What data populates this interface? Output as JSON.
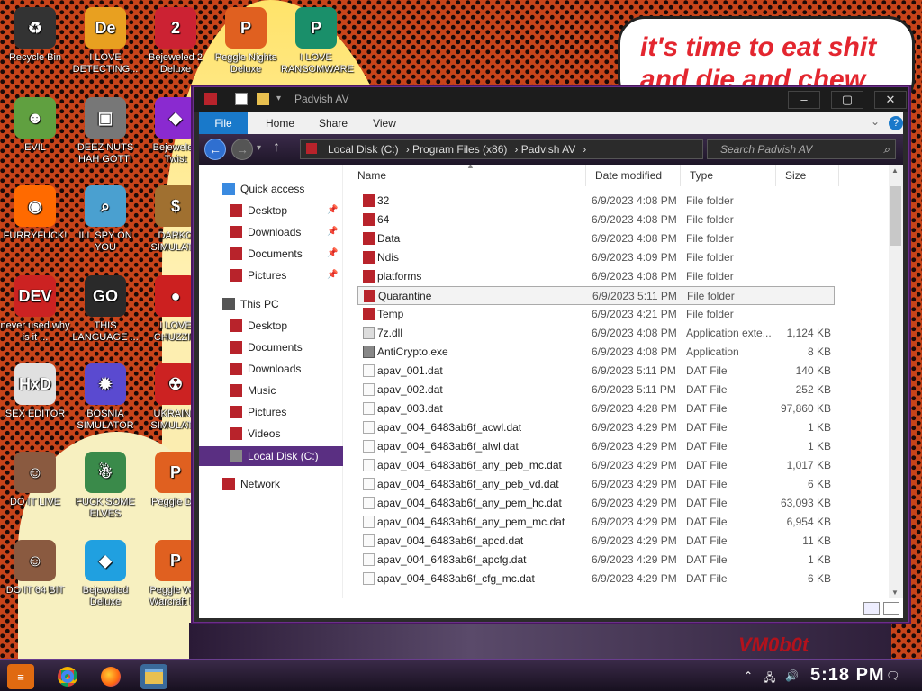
{
  "wallpaper": {
    "speech_text": "it's time to eat shit and die and chew",
    "watermark": "VM0b0t"
  },
  "desktop_icons": [
    {
      "label": "Recycle Bin",
      "glyph": "♻",
      "color": "#333333"
    },
    {
      "label": "I LOVE DETECTING...",
      "glyph": "De",
      "color": "#e8a020"
    },
    {
      "label": "Bejeweled 2 Deluxe",
      "glyph": "2",
      "color": "#cc2233"
    },
    {
      "label": "Peggle Nights Deluxe",
      "glyph": "P",
      "color": "#e06020"
    },
    {
      "label": "I LOVE RANSOMWARE",
      "glyph": "P",
      "color": "#1a8f6a"
    },
    {
      "label": "EVIL",
      "glyph": "☻",
      "color": "#60a040"
    },
    {
      "label": "DEEZ NUTS HAH GOTTI",
      "glyph": "▣",
      "color": "#777777"
    },
    {
      "label": "Bejeweled Twist",
      "glyph": "◆",
      "color": "#8a2ad0"
    },
    {
      "label": "FURRYFUCK!",
      "glyph": "◉",
      "color": "#ff6a00"
    },
    {
      "label": "ILL SPY ON YOU",
      "glyph": "⌕",
      "color": "#4aa0d0"
    },
    {
      "label": "DARKO SIMULATO",
      "glyph": "$",
      "color": "#a07030"
    },
    {
      "label": "never used why is it ...",
      "glyph": "DEV",
      "color": "#cc2222"
    },
    {
      "label": "THIS LANGUAGE ...",
      "glyph": "GO",
      "color": "#2a2a2a"
    },
    {
      "label": "I LOVE CHUZZIN",
      "glyph": "●",
      "color": "#cc2020"
    },
    {
      "label": "SEX EDITOR",
      "glyph": "HxD",
      "color": "#e0e0e0"
    },
    {
      "label": "BOSNIA SIMULATOR",
      "glyph": "✹",
      "color": "#5a4ad0"
    },
    {
      "label": "UKRAINE SIMULATO",
      "glyph": "☢",
      "color": "#cc2222"
    },
    {
      "label": "DO IT LIVE",
      "glyph": "☺",
      "color": "#8a5a40"
    },
    {
      "label": "FUCK SOME ELVES",
      "glyph": "☃",
      "color": "#3a8a4a"
    },
    {
      "label": "Peggle Del",
      "glyph": "P",
      "color": "#e06020"
    },
    {
      "label": "DO IT 64 BIT",
      "glyph": "☺",
      "color": "#8a5a40"
    },
    {
      "label": "Bejeweled Deluxe",
      "glyph": "◆",
      "color": "#20a0e0"
    },
    {
      "label": "Peggle Wor Warcraft Ed",
      "glyph": "P",
      "color": "#e06020"
    }
  ],
  "window": {
    "title": "Padvish AV",
    "min": "–",
    "max": "▢",
    "close": "✕",
    "help": "?",
    "ribbon_expand": "⌄",
    "tabs": [
      "File",
      "Home",
      "Share",
      "View"
    ],
    "breadcrumb": [
      "Local Disk (C:)",
      "Program Files (x86)",
      "Padvish AV"
    ],
    "search_placeholder": "Search Padvish AV",
    "columns": {
      "name": "Name",
      "date": "Date modified",
      "type": "Type",
      "size": "Size"
    },
    "nav": {
      "quick_access": "Quick access",
      "quick_items": [
        "Desktop",
        "Downloads",
        "Documents",
        "Pictures"
      ],
      "this_pc": "This PC",
      "pc_items": [
        "Desktop",
        "Documents",
        "Downloads",
        "Music",
        "Pictures",
        "Videos"
      ],
      "local_disk": "Local Disk (C:)",
      "network": "Network",
      "pin": "📌"
    },
    "files": [
      {
        "name": "32",
        "date": "6/9/2023 4:08 PM",
        "type": "File folder",
        "size": "",
        "kind": "folder"
      },
      {
        "name": "64",
        "date": "6/9/2023 4:08 PM",
        "type": "File folder",
        "size": "",
        "kind": "folder"
      },
      {
        "name": "Data",
        "date": "6/9/2023 4:08 PM",
        "type": "File folder",
        "size": "",
        "kind": "folder"
      },
      {
        "name": "Ndis",
        "date": "6/9/2023 4:09 PM",
        "type": "File folder",
        "size": "",
        "kind": "folder"
      },
      {
        "name": "platforms",
        "date": "6/9/2023 4:08 PM",
        "type": "File folder",
        "size": "",
        "kind": "folder"
      },
      {
        "name": "Quarantine",
        "date": "6/9/2023 5:11 PM",
        "type": "File folder",
        "size": "",
        "kind": "folder",
        "selected": true
      },
      {
        "name": "Temp",
        "date": "6/9/2023 4:21 PM",
        "type": "File folder",
        "size": "",
        "kind": "folder"
      },
      {
        "name": "7z.dll",
        "date": "6/9/2023 4:08 PM",
        "type": "Application exte...",
        "size": "1,124 KB",
        "kind": "dll"
      },
      {
        "name": "AntiCrypto.exe",
        "date": "6/9/2023 4:08 PM",
        "type": "Application",
        "size": "8 KB",
        "kind": "exe"
      },
      {
        "name": "apav_001.dat",
        "date": "6/9/2023 5:11 PM",
        "type": "DAT File",
        "size": "140 KB",
        "kind": "file"
      },
      {
        "name": "apav_002.dat",
        "date": "6/9/2023 5:11 PM",
        "type": "DAT File",
        "size": "252 KB",
        "kind": "file"
      },
      {
        "name": "apav_003.dat",
        "date": "6/9/2023 4:28 PM",
        "type": "DAT File",
        "size": "97,860 KB",
        "kind": "file"
      },
      {
        "name": "apav_004_6483ab6f_acwl.dat",
        "date": "6/9/2023 4:29 PM",
        "type": "DAT File",
        "size": "1 KB",
        "kind": "file"
      },
      {
        "name": "apav_004_6483ab6f_alwl.dat",
        "date": "6/9/2023 4:29 PM",
        "type": "DAT File",
        "size": "1 KB",
        "kind": "file"
      },
      {
        "name": "apav_004_6483ab6f_any_peb_mc.dat",
        "date": "6/9/2023 4:29 PM",
        "type": "DAT File",
        "size": "1,017 KB",
        "kind": "file"
      },
      {
        "name": "apav_004_6483ab6f_any_peb_vd.dat",
        "date": "6/9/2023 4:29 PM",
        "type": "DAT File",
        "size": "6 KB",
        "kind": "file"
      },
      {
        "name": "apav_004_6483ab6f_any_pem_hc.dat",
        "date": "6/9/2023 4:29 PM",
        "type": "DAT File",
        "size": "63,093 KB",
        "kind": "file"
      },
      {
        "name": "apav_004_6483ab6f_any_pem_mc.dat",
        "date": "6/9/2023 4:29 PM",
        "type": "DAT File",
        "size": "6,954 KB",
        "kind": "file"
      },
      {
        "name": "apav_004_6483ab6f_apcd.dat",
        "date": "6/9/2023 4:29 PM",
        "type": "DAT File",
        "size": "11 KB",
        "kind": "file"
      },
      {
        "name": "apav_004_6483ab6f_apcfg.dat",
        "date": "6/9/2023 4:29 PM",
        "type": "DAT File",
        "size": "1 KB",
        "kind": "file"
      },
      {
        "name": "apav_004_6483ab6f_cfg_mc.dat",
        "date": "6/9/2023 4:29 PM",
        "type": "DAT File",
        "size": "6 KB",
        "kind": "file"
      }
    ]
  },
  "taskbar": {
    "clock": "5:18 PM",
    "apps": [
      "start-icon",
      "chrome-icon",
      "firefox-icon",
      "file-explorer-icon"
    ]
  },
  "colors": {
    "selection": "#5a2f82",
    "accent": "#1979ca",
    "folder_red": "#b8232b"
  }
}
